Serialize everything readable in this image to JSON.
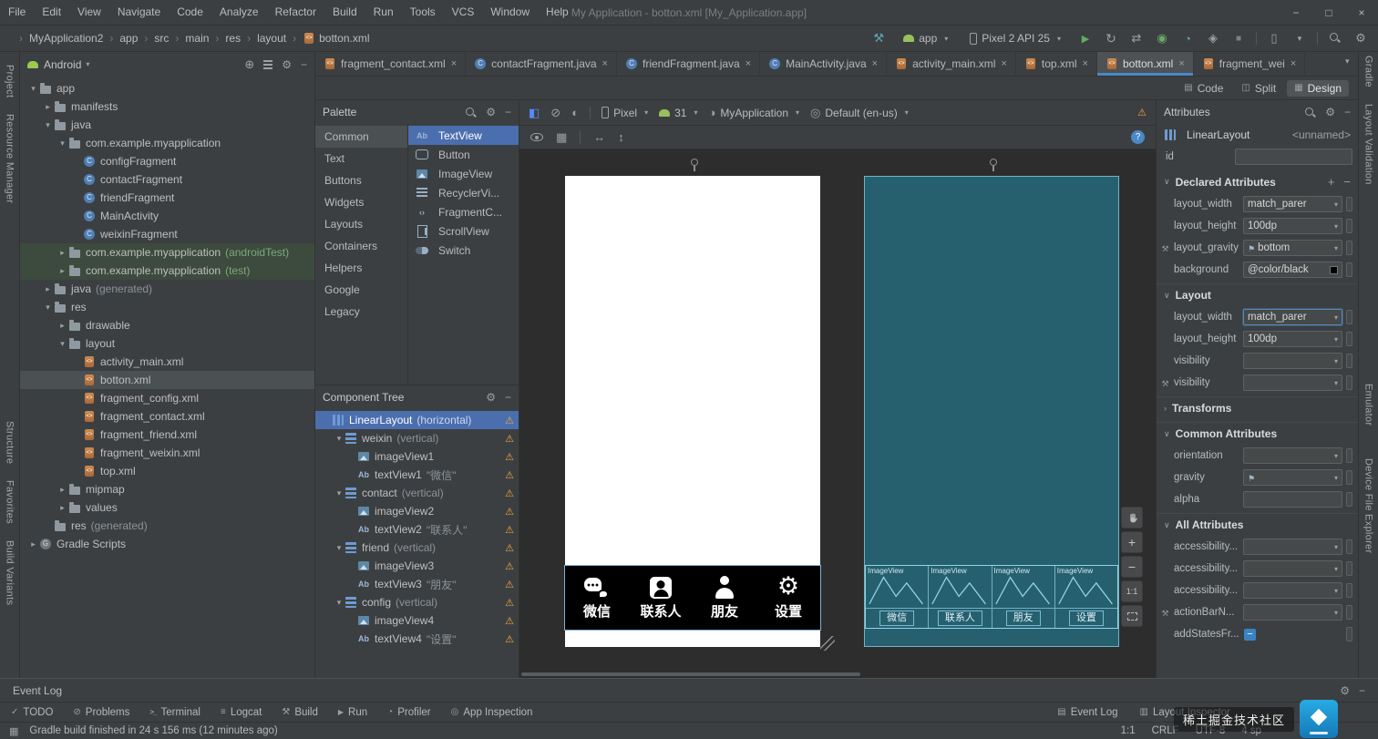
{
  "menubar": {
    "items": [
      "File",
      "Edit",
      "View",
      "Navigate",
      "Code",
      "Analyze",
      "Refactor",
      "Build",
      "Run",
      "Tools",
      "VCS",
      "Window",
      "Help"
    ],
    "title": "My Application - botton.xml [My_Application.app]"
  },
  "navbar": {
    "breadcrumbs": [
      {
        "label": "MyApplication2"
      },
      {
        "label": "app"
      },
      {
        "label": "src"
      },
      {
        "label": "main"
      },
      {
        "label": "res"
      },
      {
        "label": "layout"
      },
      {
        "label": "botton.xml",
        "icon": "xml"
      }
    ],
    "run_config": "app",
    "device": "Pixel 2 API 25",
    "icons_right": [
      "run",
      "apply-changes",
      "attach-debugger",
      "debug",
      "profiler",
      "coverage",
      "stop",
      "divider",
      "device-manager",
      "sdk-manager",
      "divider",
      "search",
      "settings"
    ]
  },
  "stripes": {
    "left": [
      "Project",
      "Resource Manager",
      "Structure",
      "Favorites",
      "Build Variants"
    ],
    "right": [
      "Gradle",
      "Layout Validation",
      "Emulator",
      "Device File Explorer"
    ]
  },
  "project": {
    "selector": "Android",
    "tree": [
      {
        "lvl": 0,
        "chev": "open",
        "icon": "folder",
        "label": "app"
      },
      {
        "lvl": 1,
        "chev": "closed",
        "icon": "folder",
        "label": "manifests"
      },
      {
        "lvl": 1,
        "chev": "open",
        "icon": "folder",
        "label": "java"
      },
      {
        "lvl": 2,
        "chev": "open",
        "icon": "folder",
        "label": "com.example.myapplication"
      },
      {
        "lvl": 3,
        "icon": "class",
        "label": "configFragment"
      },
      {
        "lvl": 3,
        "icon": "class",
        "label": "contactFragment"
      },
      {
        "lvl": 3,
        "icon": "class",
        "label": "friendFragment"
      },
      {
        "lvl": 3,
        "icon": "class",
        "label": "MainActivity"
      },
      {
        "lvl": 3,
        "icon": "class",
        "label": "weixinFragment"
      },
      {
        "lvl": 2,
        "chev": "closed",
        "icon": "folder",
        "label": "com.example.myapplication",
        "suffix": "(androidTest)",
        "cls": "green"
      },
      {
        "lvl": 2,
        "chev": "closed",
        "icon": "folder",
        "label": "com.example.myapplication",
        "suffix": "(test)",
        "cls": "green"
      },
      {
        "lvl": 1,
        "chev": "closed",
        "icon": "folder",
        "label": "java",
        "suffix": "(generated)"
      },
      {
        "lvl": 1,
        "chev": "open",
        "icon": "folder",
        "label": "res"
      },
      {
        "lvl": 2,
        "chev": "closed",
        "icon": "folder",
        "label": "drawable"
      },
      {
        "lvl": 2,
        "chev": "open",
        "icon": "folder",
        "label": "layout"
      },
      {
        "lvl": 3,
        "icon": "xml",
        "label": "activity_main.xml"
      },
      {
        "lvl": 3,
        "icon": "xml",
        "label": "botton.xml",
        "cls": "selected"
      },
      {
        "lvl": 3,
        "icon": "xml",
        "label": "fragment_config.xml"
      },
      {
        "lvl": 3,
        "icon": "xml",
        "label": "fragment_contact.xml"
      },
      {
        "lvl": 3,
        "icon": "xml",
        "label": "fragment_friend.xml"
      },
      {
        "lvl": 3,
        "icon": "xml",
        "label": "fragment_weixin.xml"
      },
      {
        "lvl": 3,
        "icon": "xml",
        "label": "top.xml"
      },
      {
        "lvl": 2,
        "chev": "closed",
        "icon": "folder",
        "label": "mipmap"
      },
      {
        "lvl": 2,
        "chev": "closed",
        "icon": "folder",
        "label": "values"
      },
      {
        "lvl": 1,
        "icon": "folder",
        "label": "res",
        "suffix": "(generated)"
      },
      {
        "lvl": 0,
        "chev": "closed",
        "icon": "gradle",
        "label": "Gradle Scripts"
      }
    ]
  },
  "editor_tabs": [
    {
      "icon": "xml",
      "label": "fragment_contact.xml"
    },
    {
      "icon": "java",
      "label": "contactFragment.java"
    },
    {
      "icon": "java",
      "label": "friendFragment.java"
    },
    {
      "icon": "java",
      "label": "MainActivity.java"
    },
    {
      "icon": "xml",
      "label": "activity_main.xml"
    },
    {
      "icon": "xml",
      "label": "top.xml"
    },
    {
      "icon": "xml",
      "label": "botton.xml",
      "cls": "active"
    },
    {
      "icon": "xml",
      "label": "fragment_wei"
    }
  ],
  "editor_modes": {
    "code": "Code",
    "split": "Split",
    "design": "Design"
  },
  "palette": {
    "title": "Palette",
    "categories": [
      {
        "label": "Common",
        "cls": "sel"
      },
      {
        "label": "Text"
      },
      {
        "label": "Buttons"
      },
      {
        "label": "Widgets"
      },
      {
        "label": "Layouts"
      },
      {
        "label": "Containers"
      },
      {
        "label": "Helpers"
      },
      {
        "label": "Google"
      },
      {
        "label": "Legacy"
      }
    ],
    "items": [
      {
        "icon": "ab",
        "label": "TextView",
        "cls": "sel"
      },
      {
        "icon": "button-w",
        "label": "Button"
      },
      {
        "icon": "image",
        "label": "ImageView"
      },
      {
        "icon": "recycler",
        "label": "RecyclerVi..."
      },
      {
        "icon": "fragmentc",
        "label": "FragmentC..."
      },
      {
        "icon": "scroll",
        "label": "ScrollView"
      },
      {
        "icon": "switch",
        "label": "Switch"
      }
    ]
  },
  "component_tree": {
    "title": "Component Tree",
    "rows": [
      {
        "lvl": 0,
        "icon": "linear",
        "label": "LinearLayout",
        "suffix": "(horizontal)",
        "cls": "sel"
      },
      {
        "lvl": 1,
        "chev": "open",
        "icon": "linear-v",
        "label": "weixin",
        "suffix": "(vertical)"
      },
      {
        "lvl": 2,
        "icon": "image",
        "label": "imageView1"
      },
      {
        "lvl": 2,
        "icon": "ab",
        "label": "textView1",
        "suffix": "\"微信\""
      },
      {
        "lvl": 1,
        "chev": "open",
        "icon": "linear-v",
        "label": "contact",
        "suffix": "(vertical)"
      },
      {
        "lvl": 2,
        "icon": "image",
        "label": "imageView2"
      },
      {
        "lvl": 2,
        "icon": "ab",
        "label": "textView2",
        "suffix": "\"联系人\""
      },
      {
        "lvl": 1,
        "chev": "open",
        "icon": "linear-v",
        "label": "friend",
        "suffix": "(vertical)"
      },
      {
        "lvl": 2,
        "icon": "image",
        "label": "imageView3"
      },
      {
        "lvl": 2,
        "icon": "ab",
        "label": "textView3",
        "suffix": "\"朋友\""
      },
      {
        "lvl": 1,
        "chev": "open",
        "icon": "linear-v",
        "label": "config",
        "suffix": "(vertical)"
      },
      {
        "lvl": 2,
        "icon": "image",
        "label": "imageView4"
      },
      {
        "lvl": 2,
        "icon": "ab",
        "label": "textView4",
        "suffix": "\"设置\""
      }
    ]
  },
  "design_bar": {
    "device": "Pixel",
    "api": "31",
    "theme": "MyApplication",
    "locale": "Default (en-us)"
  },
  "preview": {
    "nav_items": [
      {
        "icon": "chat",
        "label": "微信"
      },
      {
        "icon": "contactbook",
        "label": "联系人"
      },
      {
        "icon": "person",
        "label": "朋友"
      },
      {
        "icon": "gearw",
        "label": "设置"
      }
    ],
    "blueprint_cells": [
      {
        "box_label": "ImageView",
        "text": "微信"
      },
      {
        "box_label": "ImageView",
        "text": "联系人"
      },
      {
        "box_label": "ImageView",
        "text": "朋友"
      },
      {
        "box_label": "ImageView",
        "text": "设置"
      }
    ],
    "zoom_actual": "1:1"
  },
  "attributes": {
    "title": "Attributes",
    "component_type": "LinearLayout",
    "component_name": "<unnamed>",
    "id_label": "id",
    "id_value": "",
    "declared_title": "Declared Attributes",
    "declared_rows": [
      {
        "label": "layout_width",
        "value": "match_parer",
        "type": "dropdown"
      },
      {
        "label": "layout_height",
        "value": "100dp",
        "type": "dropdown"
      },
      {
        "label": "layout_gravity",
        "value": "bottom",
        "type": "dropdown",
        "flag": "y",
        "wrench": "y"
      },
      {
        "label": "background",
        "value": "@color/black",
        "type": "plain",
        "swatch": "y"
      }
    ],
    "layout_title": "Layout",
    "layout_rows": [
      {
        "label": "layout_width",
        "value": "match_parer",
        "type": "dropdown",
        "cls": "focus"
      },
      {
        "label": "layout_height",
        "value": "100dp",
        "type": "dropdown"
      },
      {
        "label": "visibility",
        "value": "",
        "type": "dropdown"
      },
      {
        "label": "visibility",
        "value": "",
        "type": "dropdown",
        "wrench": "y"
      }
    ],
    "transforms_title": "Transforms",
    "common_title": "Common Attributes",
    "common_rows": [
      {
        "label": "orientation",
        "value": "",
        "type": "dropdown"
      },
      {
        "label": "gravity",
        "value": "",
        "type": "dropdown",
        "flag": "y"
      },
      {
        "label": "alpha",
        "value": "",
        "type": "text"
      }
    ],
    "all_title": "All Attributes",
    "all_rows": [
      {
        "label": "accessibility...",
        "value": "",
        "type": "dropdown"
      },
      {
        "label": "accessibility...",
        "value": "",
        "type": "dropdown"
      },
      {
        "label": "accessibility...",
        "value": "",
        "type": "dropdown"
      },
      {
        "label": "actionBarN...",
        "value": "",
        "type": "dropdown",
        "wrench": "y"
      },
      {
        "label": "addStatesFr...",
        "value": "",
        "type": "checkbox"
      }
    ]
  },
  "event_log": {
    "title": "Event Log"
  },
  "bottom_bar": {
    "left_items": [
      {
        "icon": "todo",
        "label": "TODO"
      },
      {
        "icon": "problems",
        "label": "Problems"
      },
      {
        "icon": "terminal",
        "label": "Terminal"
      },
      {
        "icon": "logcat",
        "label": "Logcat"
      },
      {
        "icon": "build",
        "label": "Build"
      },
      {
        "icon": "runb",
        "label": "Run"
      },
      {
        "icon": "profilerb",
        "label": "Profiler"
      },
      {
        "icon": "inspection",
        "label": "App Inspection"
      }
    ],
    "right_items": [
      {
        "icon": "eventlog",
        "label": "Event Log"
      },
      {
        "icon": "inspector",
        "label": "Layout Inspector"
      }
    ]
  },
  "statusbar": {
    "message": "Gradle build finished in 24 s 156 ms (12 minutes ago)",
    "items": [
      "1:1",
      "CRLF",
      "UTF-8",
      "4 sp"
    ]
  },
  "watermark": {
    "text": "稀土掘金技术社区"
  }
}
